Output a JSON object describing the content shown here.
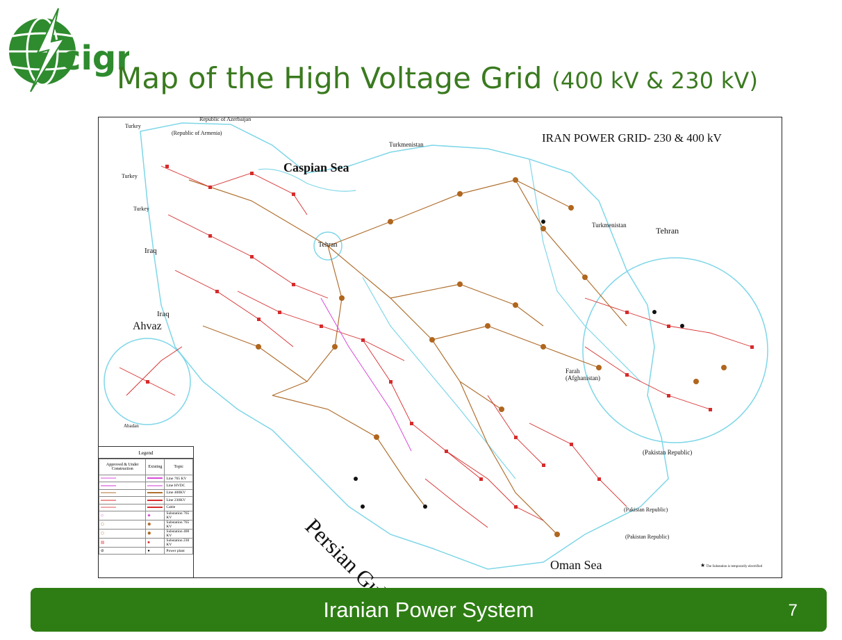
{
  "logo": {
    "text": "cigré"
  },
  "title": {
    "main": "Map of the High Voltage Grid",
    "sub": "(400 kV & 230 kV)"
  },
  "map": {
    "heading": "IRAN POWER GRID- 230 & 400 kV",
    "seas": {
      "caspian": "Caspian Sea",
      "persian_gulf": "Persian Gulf",
      "oman": "Oman  Sea"
    },
    "countries": {
      "turkey1": "Turkey",
      "turkey2": "Turkey",
      "turkey3": "Turkey",
      "armenia": "(Republic of Armenia)",
      "azerbaijan": "Republic of Azerbaijan",
      "turkmenistan1": "Turkmenistan",
      "turkmenistan2": "Turkmenistan",
      "iraq1": "Iraq",
      "iraq2": "Iraq",
      "afghanistan": "Farah\n(Afghanistan)",
      "pakistan1": "(Pakistan Republic)",
      "pakistan2": "(Pakistan Republic)",
      "pakistan3": "(Pakistan Republic)"
    },
    "insets": {
      "tehran_main": "Tehran",
      "tehran_inset": "Tehran",
      "ahvaz_inset": "Ahvaz",
      "abadan": "Abadan"
    },
    "note": "The Substation is temporarily electrified"
  },
  "legend": {
    "title": "Legend",
    "col1": "Approved & Under Construction",
    "col2": "Existing",
    "col3": "Topic",
    "rows": [
      "Line 765 KV",
      "Line HVDC",
      "Line 400KV",
      "Line 230KV",
      "Cable",
      "Substation 765 KV",
      "Substation 765 KV",
      "Substation 400 KV",
      "Substation 230 KV",
      "Power plant"
    ]
  },
  "footer": {
    "text": "Iranian Power System",
    "page": "7"
  },
  "colors": {
    "title_green": "#3a7a1f",
    "footer_green": "#2e7d14",
    "line_400": "#b07030",
    "line_230": "#d62b2b",
    "border": "#7ed6e8"
  }
}
